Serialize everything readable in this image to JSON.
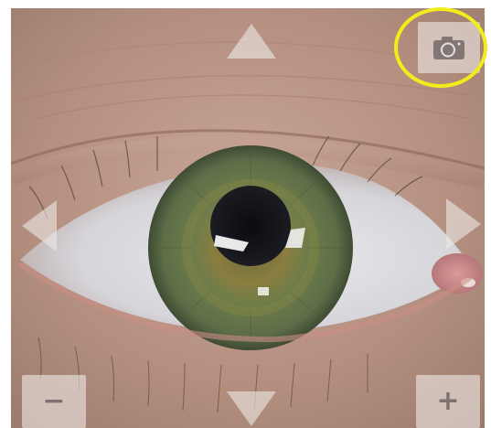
{
  "app": {
    "view": "eye-camera-live-view"
  },
  "controls": {
    "pan_up_icon": "triangle-up-icon",
    "pan_down_icon": "triangle-down-icon",
    "pan_left_icon": "triangle-left-icon",
    "pan_right_icon": "triangle-right-icon",
    "capture_icon": "camera-icon",
    "zoom_out_label": "−",
    "zoom_in_label": "+"
  },
  "colors": {
    "control_fill": "#ebe6e4",
    "control_glyph": "#7a6e6c",
    "highlight_ring": "#f2ec1b",
    "iris": "#6f7a45",
    "sclera": "#dfe0e4",
    "skin": "#b89484"
  }
}
